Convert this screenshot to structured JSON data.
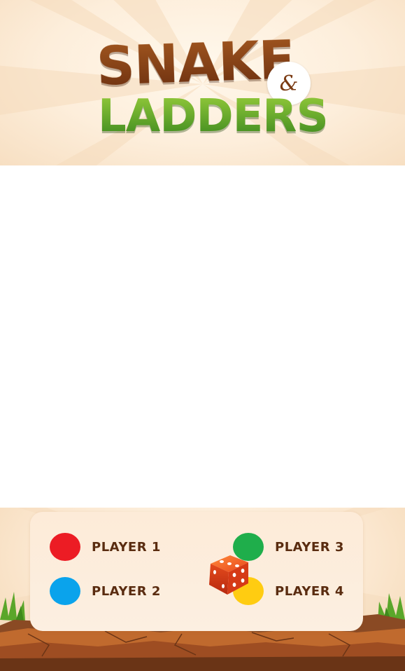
{
  "header": {
    "logo_line1": "SNAKE",
    "logo_amp": "&",
    "logo_line2": "LADDERS"
  },
  "players": [
    {
      "label": "PLAYER 1",
      "color": "#ec1c24"
    },
    {
      "label": "PLAYER 2",
      "color": "#0aa3ec"
    },
    {
      "label": "PLAYER 3",
      "color": "#1fae4b"
    },
    {
      "label": "PLAYER 4",
      "color": "#ffcc11"
    }
  ],
  "dice": {
    "icon": "dice-icon",
    "color": "#e8461c"
  },
  "colors": {
    "logo_brown": "#7a3a12",
    "logo_green": "#4f9a26",
    "panel_bg": "#fcebd8",
    "ground": "#b5582a"
  }
}
